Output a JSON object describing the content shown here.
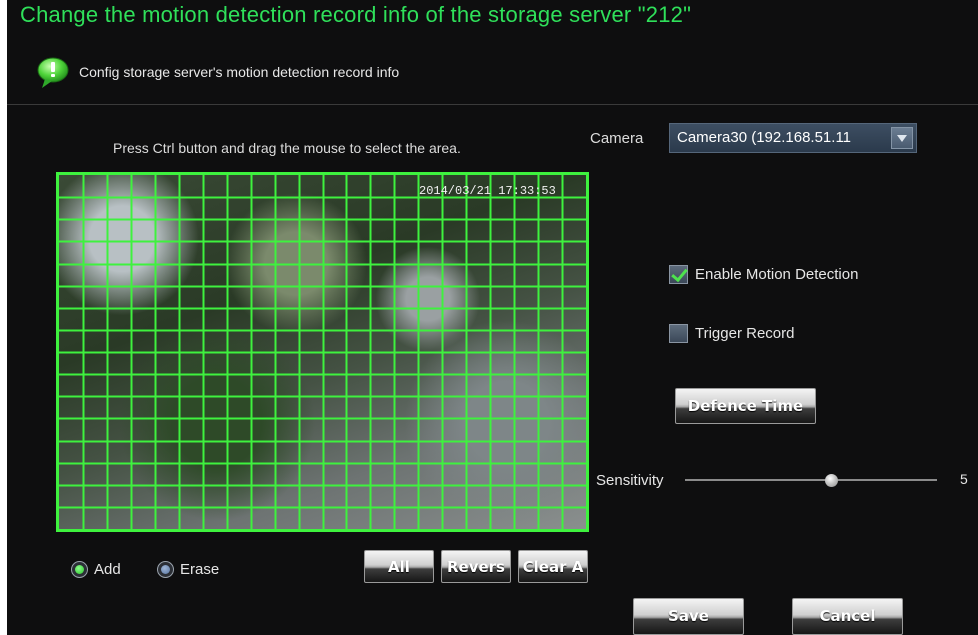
{
  "header": {
    "title": "Change the motion detection record info of the storage server \"212\"",
    "subtitle": "Config storage server's motion detection record info",
    "icon": "info-bubble-icon"
  },
  "area": {
    "instruction": "Press Ctrl button and drag the mouse to select the area.",
    "timestamp": "2014/03/21 17:33:53",
    "grid_columns": 22,
    "grid_rows": 16
  },
  "camera": {
    "label": "Camera",
    "value": "Camera30 (192.168.51.11"
  },
  "options": {
    "enable_motion_detection": {
      "label": "Enable Motion Detection",
      "checked": true
    },
    "trigger_record": {
      "label": "Trigger Record",
      "checked": false
    }
  },
  "buttons": {
    "defence_time": "Defence Time",
    "all": "All",
    "revers": "Revers",
    "clear_a": "Clear A",
    "save": "Save",
    "cancel": "Cancel"
  },
  "sensitivity": {
    "label": "Sensitivity",
    "value": "5",
    "level": 0.58
  },
  "mode": {
    "add": "Add",
    "erase": "Erase",
    "selected": "Add"
  },
  "colors": {
    "title": "#2fe05a",
    "grid": "#3ef23e",
    "background": "#0e0e0f"
  }
}
